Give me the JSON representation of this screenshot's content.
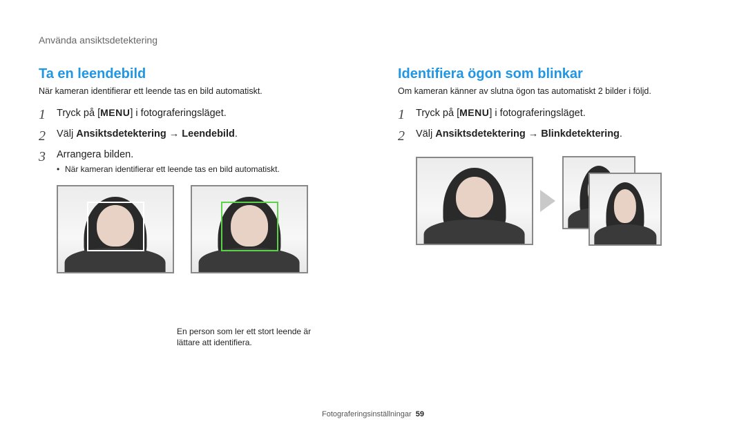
{
  "breadcrumb": "Använda ansiktsdetektering",
  "left": {
    "heading": "Ta en leendebild",
    "intro": "När kameran identifierar ett leende tas en bild automatiskt.",
    "step1_pre": "Tryck på [",
    "menu_label": "MENU",
    "step1_post": "] i fotograferingsläget.",
    "step2_pre": "Välj ",
    "step2_bold": "Ansiktsdetektering → Leendebild",
    "step2_post": ".",
    "step3": "Arrangera bilden.",
    "bullet": "När kameran identifierar ett leende tas en bild automatiskt.",
    "caption": "En person som ler ett stort leende är lättare att identifiera."
  },
  "right": {
    "heading": "Identifiera ögon som blinkar",
    "intro": "Om kameran känner av slutna ögon tas automatiskt 2 bilder i följd.",
    "step1_pre": "Tryck på [",
    "menu_label": "MENU",
    "step1_post": "] i fotograferingsläget.",
    "step2_pre": "Välj ",
    "step2_bold": "Ansiktsdetektering → Blinkdetektering",
    "step2_post": "."
  },
  "footer_label": "Fotograferingsinställningar",
  "page_number": "59"
}
